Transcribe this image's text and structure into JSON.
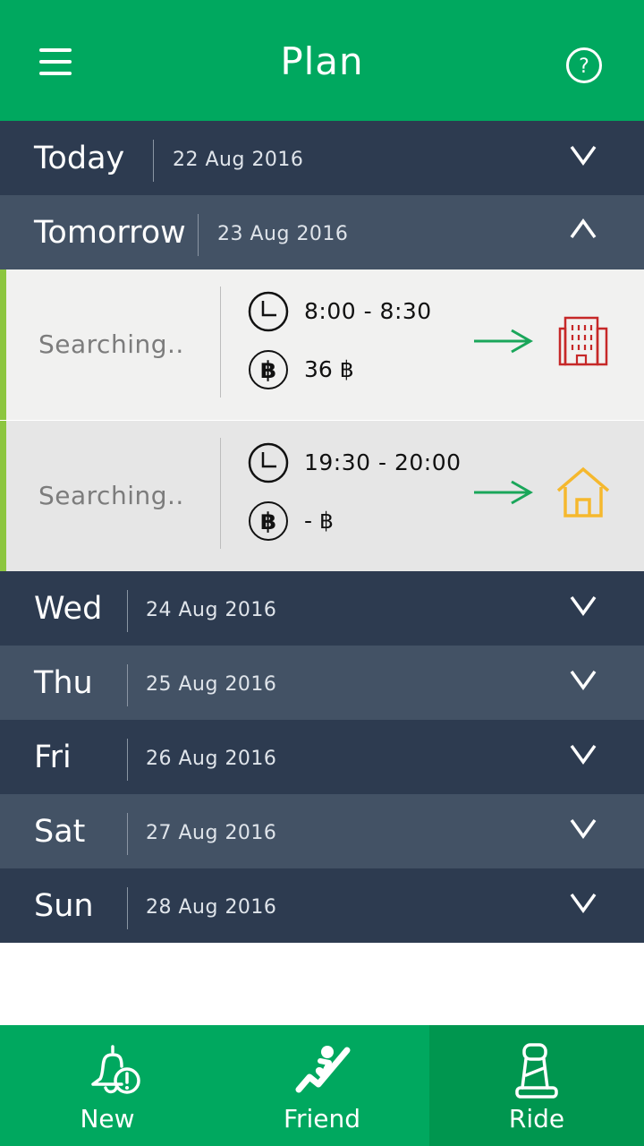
{
  "header": {
    "title": "Plan"
  },
  "days": [
    {
      "name": "Today",
      "date": "22 Aug 2016"
    },
    {
      "name": "Tomorrow",
      "date": "23 Aug 2016"
    },
    {
      "name": "Wed",
      "date": "24 Aug 2016"
    },
    {
      "name": "Thu",
      "date": "25 Aug 2016"
    },
    {
      "name": "Fri",
      "date": "26 Aug 2016"
    },
    {
      "name": "Sat",
      "date": "27 Aug 2016"
    },
    {
      "name": "Sun",
      "date": "28 Aug 2016"
    }
  ],
  "trips": [
    {
      "status": "Searching..",
      "time": "8:00 - 8:30",
      "price": "36 ฿",
      "destination_icon": "building-icon"
    },
    {
      "status": "Searching..",
      "time": "19:30 - 20:00",
      "price": "- ฿",
      "destination_icon": "home-icon"
    }
  ],
  "tabs": [
    {
      "label": "New",
      "icon": "bell-alert-icon"
    },
    {
      "label": "Friend",
      "icon": "friend-icon"
    },
    {
      "label": "Ride",
      "icon": "seat-icon",
      "active": true
    }
  ],
  "colors": {
    "primary": "#00a85f",
    "row_dark": "#2d3b50",
    "row_light": "#435265",
    "trip_bar": "#8cc63f",
    "building": "#c62828",
    "home": "#f5b82e"
  }
}
